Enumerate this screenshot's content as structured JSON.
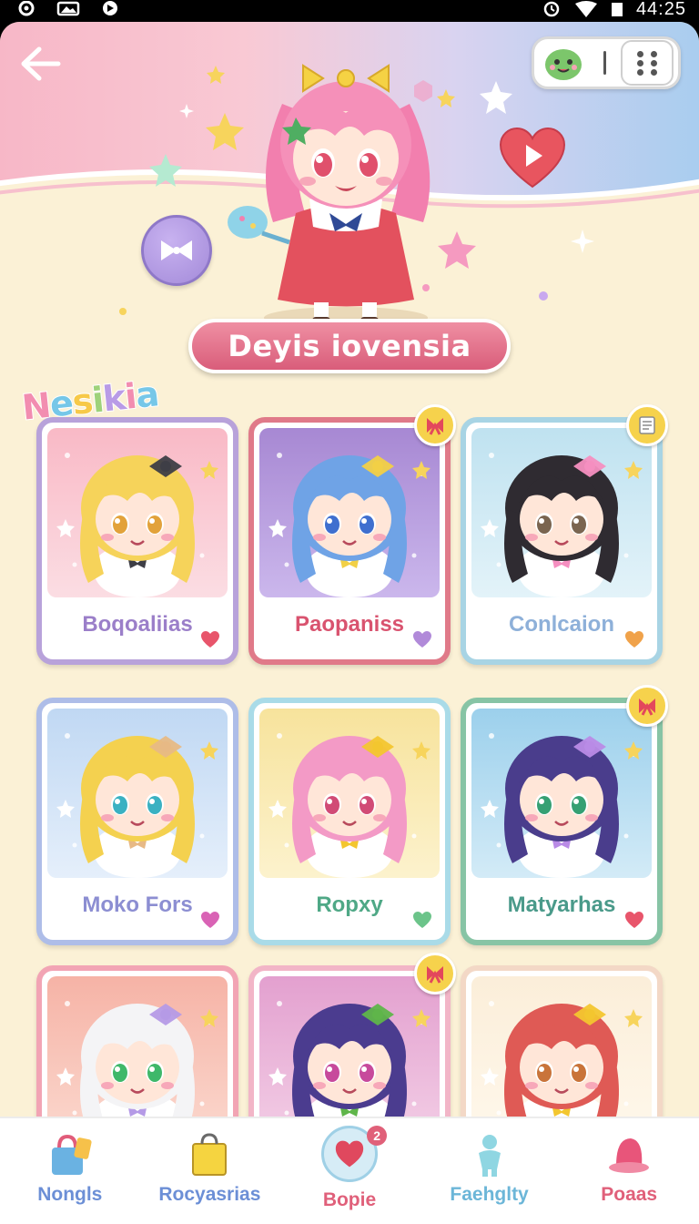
{
  "status_bar": {
    "time": "44:25",
    "icons": [
      "media-icon",
      "photo-icon",
      "navigation-icon",
      "alarm-icon",
      "wifi-icon",
      "battery-icon"
    ]
  },
  "header": {
    "back_icon": "back-arrow-icon",
    "pill": {
      "avatar_icon": "green-creature-icon",
      "menu_icon": "grid-menu-icon"
    },
    "hero_buttons": [
      "bow-icon",
      "heart-play-icon"
    ]
  },
  "title_banner": "Deyis iovensia",
  "section_label": {
    "letters": [
      "N",
      "e",
      "s",
      "i",
      "k",
      "i",
      "a"
    ],
    "colors": [
      "#f28db0",
      "#76c7e8",
      "#f7c948",
      "#9ed27a",
      "#b99be6",
      "#f28db0",
      "#76c7e8"
    ]
  },
  "cards": [
    {
      "name": "Boqoaliias",
      "name_color": "#9b7fc9",
      "border": "#b8a2da",
      "bg": [
        "#f9b9c6",
        "#fbdde3"
      ],
      "hair": "#f6d35a",
      "eyes": "#e2a23a",
      "accent": "#3e3e46",
      "fav_color": "#e8556b",
      "badge": null
    },
    {
      "name": "Paopaniss",
      "name_color": "#d9536f",
      "border": "#e07a89",
      "bg": [
        "#a788d3",
        "#cbb7ec"
      ],
      "hair": "#6fa3e6",
      "eyes": "#3f6fcf",
      "accent": "#f2d046",
      "fav_color": "#b18ad9",
      "badge": "ribbon-icon"
    },
    {
      "name": "Conlcaion",
      "name_color": "#8eb0d9",
      "border": "#a8d4e4",
      "bg": [
        "#bfe2f0",
        "#e3f3f9"
      ],
      "hair": "#2f2b31",
      "eyes": "#7a6550",
      "accent": "#f58fc0",
      "fav_color": "#f0a24a",
      "badge": "note-icon"
    },
    {
      "name": "Moko Fors",
      "name_color": "#8c8ed2",
      "border": "#aebde8",
      "bg": [
        "#c0d8f3",
        "#e5effb"
      ],
      "hair": "#f4d14f",
      "eyes": "#3ab1c2",
      "accent": "#e7b985",
      "fav_color": "#d963b5",
      "badge": null
    },
    {
      "name": "Ropxy",
      "name_color": "#4fa886",
      "border": "#a9dbe8",
      "bg": [
        "#f7e39c",
        "#fcf2cd"
      ],
      "hair": "#f39ac6",
      "eyes": "#d14b76",
      "accent": "#f3c62f",
      "fav_color": "#6cc48a",
      "badge": null
    },
    {
      "name": "Matyarhas",
      "name_color": "#4a9a8a",
      "border": "#87c4a5",
      "bg": [
        "#9cd0ec",
        "#d3ebf7"
      ],
      "hair": "#4a3d8c",
      "eyes": "#36a073",
      "accent": "#b98be6",
      "fav_color": "#e8556b",
      "badge": "ribbon-icon"
    },
    {
      "name": "",
      "name_color": "#888",
      "border": "#f2a4b4",
      "bg": [
        "#f6b3a6",
        "#fbd9cf"
      ],
      "hair": "#f4f4f6",
      "eyes": "#3fb86a",
      "accent": "#b59ae6",
      "fav_color": "#e8556b",
      "badge": null
    },
    {
      "name": "",
      "name_color": "#888",
      "border": "#f2b5c7",
      "bg": [
        "#e3a0cf",
        "#f3cfe6"
      ],
      "hair": "#4b3c8f",
      "eyes": "#c74a9c",
      "accent": "#5fb54a",
      "fav_color": "#e8556b",
      "badge": "ribbon-icon"
    },
    {
      "name": "",
      "name_color": "#888",
      "border": "#f3d8c6",
      "bg": [
        "#fbeed9",
        "#fff8ec"
      ],
      "hair": "#df5a55",
      "eyes": "#c9743a",
      "accent": "#f3c62f",
      "fav_color": "#e8556b",
      "badge": null
    }
  ],
  "bottom_nav": [
    {
      "label": "Nongls",
      "icon": "shopping-bag-icon",
      "color": "#6c8fd6",
      "active": false
    },
    {
      "label": "Rocyasrias",
      "icon": "yellow-bag-icon",
      "color": "#6c8fd6",
      "active": false
    },
    {
      "label": "Bopie",
      "icon": "heart-icon",
      "color": "#e0607a",
      "active": true,
      "badge": "2"
    },
    {
      "label": "Faehglty",
      "icon": "toy-figure-icon",
      "color": "#6cb6d8",
      "active": false
    },
    {
      "label": "Poaas",
      "icon": "pink-hat-icon",
      "color": "#e0607a",
      "active": false
    }
  ]
}
